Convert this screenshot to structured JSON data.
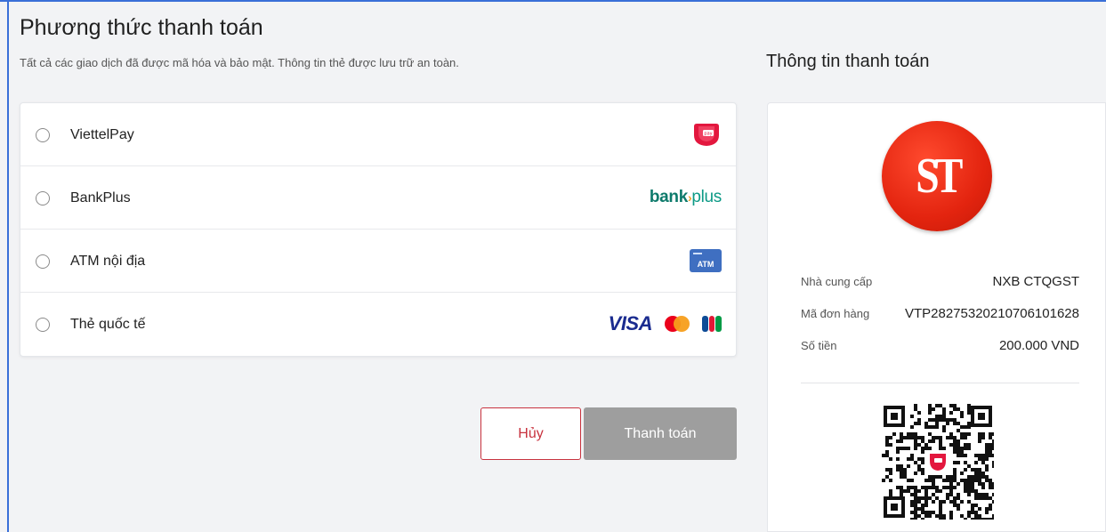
{
  "page": {
    "title": "Phương thức thanh toán",
    "subtitle": "Tất cả các giao dịch đã được mã hóa và bảo mật. Thông tin thẻ được lưu trữ an toàn."
  },
  "methods": [
    {
      "label": "ViettelPay",
      "logo": "viettelpay-logo"
    },
    {
      "label": "BankPlus",
      "logo": "bankplus-logo",
      "logo_text_a": "bank",
      "logo_text_b": "plus"
    },
    {
      "label": "ATM nội địa",
      "logo": "atm-card-icon",
      "logo_text": "ATM"
    },
    {
      "label": "Thẻ quốc tế",
      "logo": "card-network-logos",
      "visa_text": "VISA",
      "jcb_text": "JCB"
    }
  ],
  "actions": {
    "cancel_label": "Hủy",
    "pay_label": "Thanh toán"
  },
  "info": {
    "title": "Thông tin thanh toán",
    "merchant_logo_text": "ST",
    "provider_label": "Nhà cung cấp",
    "provider_value": "NXB CTQGST",
    "order_label": "Mã đơn hàng",
    "order_value": "VTP28275320210706101628",
    "amount_label": "Số tiền",
    "amount_value": "200.000 VND"
  },
  "colors": {
    "accent_red": "#c8323e",
    "pay_button_disabled": "#9e9e9e",
    "bankplus_green": "#0d7a6b",
    "visa_blue": "#1a2b8f",
    "frame_blue": "#3a6fd8"
  }
}
